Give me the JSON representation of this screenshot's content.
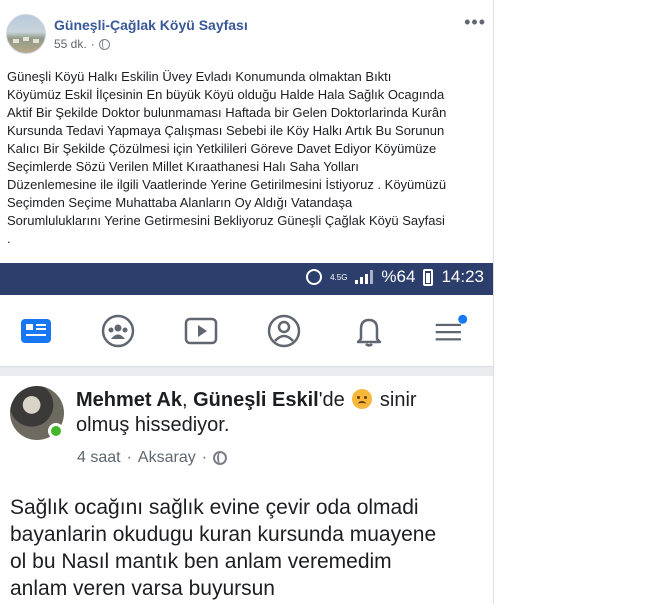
{
  "post": {
    "page_name": "Güneşli-Çağlak Köyü Sayfası",
    "time": "55 dk.",
    "separator": "·",
    "more_label": "•••",
    "body_lines": [
      "Güneşli Köyü Halkı Eskilin Üvey Evladı Konumunda olmaktan Bıktı",
      "Köyümüz Eskil İlçesinin En büyük Köyü olduğu Halde Hala Sağlık Ocagında",
      "Aktif Bir Şekilde Doktor bulunmaması Haftada bir Gelen Doktorlarinda Kurân",
      "Kursunda Tedavi Yapmaya Çalışması Sebebi ile Köy Halkı Artık Bu Sorunun",
      "Kalıcı Bir Şekilde Çözülmesi için Yetkilileri Göreve Davet Ediyor Köyümüze",
      "Seçimlerde Sözü Verilen Millet Kıraathanesi Halı Saha Yolları",
      "Düzenlemesine ile ilgili Vaatlerinde Yerine Getirilmesini İstiyoruz . Köyümüzü",
      "Seçimden Seçime Muhattaba Alanların Oy Aldığı Vatandaşa",
      "Sorumluluklarını Yerine Getirmesini Bekliyoruz Güneşli Çağlak Köyü Sayfasi",
      "."
    ]
  },
  "screenshot": {
    "status": {
      "network": "4.5G",
      "battery": "%64",
      "time": "14:23"
    },
    "nav_icons": [
      "news-feed-icon",
      "groups-icon",
      "watch-icon",
      "profile-icon",
      "notifications-icon",
      "menu-icon"
    ],
    "post": {
      "author": "Mehmet Ak",
      "location": "Güneşli Eskil",
      "location_suffix": "'de",
      "feeling_prefix": "sinir",
      "feeling_rest": "olmuş hissediyor.",
      "time": "4 saat",
      "place": "Aksaray",
      "lines": [
        "Sağlık ocağını sağlık evine çevir oda olmadi",
        "bayanlarin okudugu kuran kursunda muayene",
        "ol bu Nasıl mantık ben anlam veremedim",
        "anlam veren varsa buyursun"
      ]
    },
    "colors": {
      "statusbar": "#2c3e6b",
      "accent": "#3b5998",
      "online": "#42b72a"
    }
  }
}
